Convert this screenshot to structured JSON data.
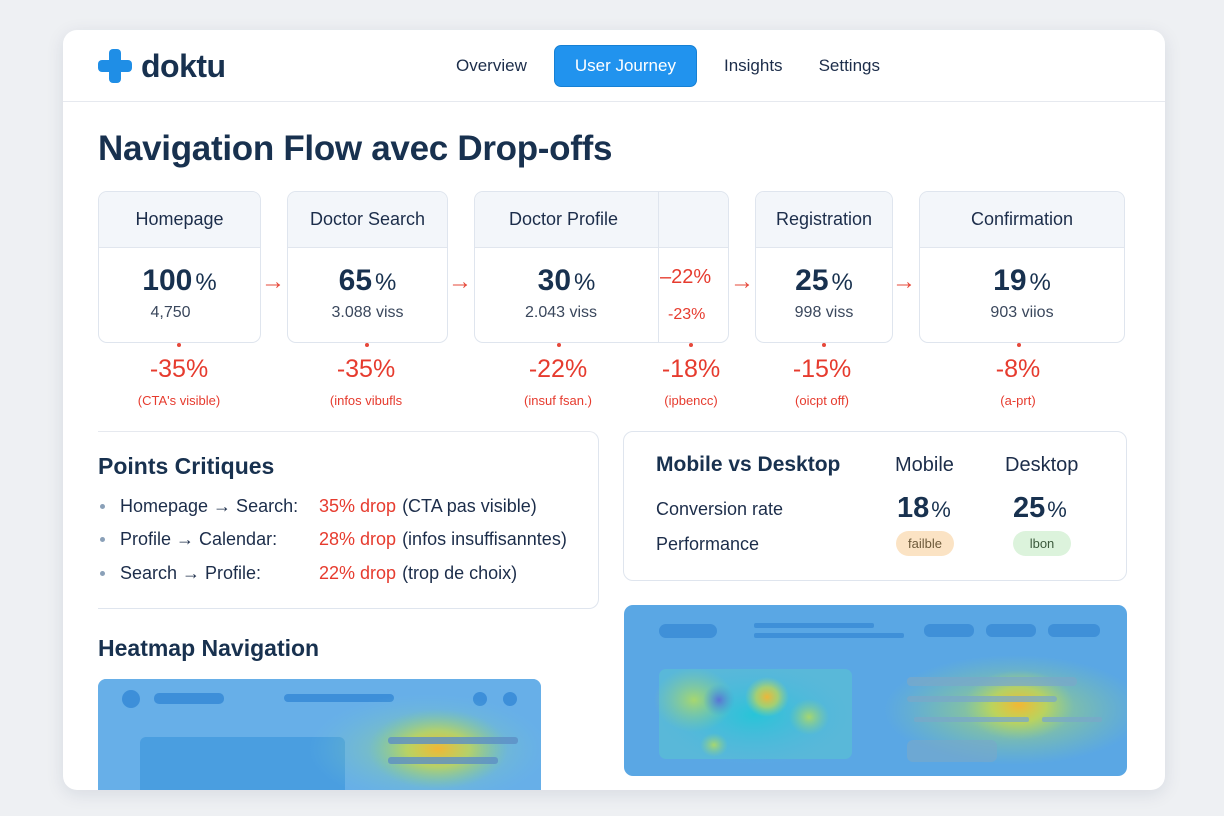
{
  "app": {
    "name": "doktu"
  },
  "nav": {
    "items": [
      "Overview",
      "User Journey",
      "Insights",
      "Settings"
    ],
    "active": "User Journey"
  },
  "page": {
    "title": "Navigation Flow avec Drop-offs"
  },
  "steps": [
    {
      "name": "Homepage",
      "pct": "100",
      "unit": "%",
      "visits": "4,750"
    },
    {
      "name": "Doctor Search",
      "pct": "65",
      "unit": "%",
      "visits": "3.088 viss"
    },
    {
      "name": "Doctor Profile",
      "pct": "30",
      "unit": "%",
      "visits": "2.043 viss"
    },
    {
      "name": "Registration",
      "pct": "25",
      "unit": "%",
      "visits": "998 viss"
    },
    {
      "name": "Confirmation",
      "pct": "19",
      "unit": "%",
      "visits": "903 viios"
    }
  ],
  "inline_drops": {
    "top": "22%",
    "bottom": "-23%"
  },
  "drops": [
    {
      "pct": "-35%",
      "note": "(CTA's visible)"
    },
    {
      "pct": "-35%",
      "note": "(infos vibufls"
    },
    {
      "pct": "-22%",
      "note": "(insuf fsan.)"
    },
    {
      "pct": "-18%",
      "note": "(ipbencc)"
    },
    {
      "pct": "-15%",
      "note": "(oicpt off)"
    },
    {
      "pct": "-8%",
      "note": "(a-prt)"
    }
  ],
  "critical": {
    "title": "Points Critiques",
    "items": [
      {
        "label": "Homepage → Search:",
        "drop": "35% drop",
        "reason": "(CTA pas visible)"
      },
      {
        "label": "Profile → Calendar:",
        "drop": "28% drop",
        "reason": "(infos insuffisanntes)"
      },
      {
        "label": "Search → Profile:",
        "drop": "22% drop",
        "reason": "(trop de choix)"
      }
    ]
  },
  "mobile_vs_desktop": {
    "title": "Mobile vs Desktop",
    "col_mobile": "Mobile",
    "col_desktop": "Desktop",
    "row_conversion": "Conversion rate",
    "row_performance": "Performance",
    "mobile_value": "18",
    "desktop_value": "25",
    "unit": "%",
    "mobile_badge": "failble",
    "desktop_badge": "lbon"
  },
  "heatmap": {
    "title": "Heatmap Navigation"
  },
  "colors": {
    "accent": "#2193ee",
    "danger": "#e63b2e",
    "title": "#18314f",
    "badge_bad": "#fbe3c4",
    "badge_good": "#dcf3dc"
  }
}
